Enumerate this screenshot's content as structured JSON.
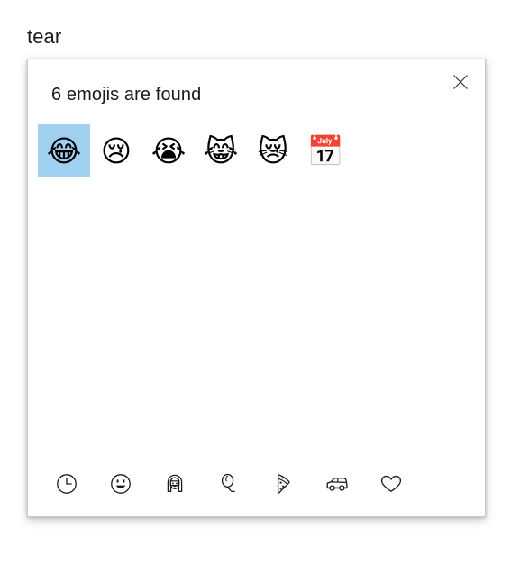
{
  "search_term": "tear",
  "panel": {
    "close_label": "✕",
    "results_header": "6 emojis are found",
    "accent_selection_color": "#9fd0f0",
    "border_color": "#c9c9c9",
    "background_color": "#ffffff"
  },
  "emoji_results": [
    {
      "glyph": "😂",
      "name": "face-with-tears-of-joy",
      "selected": true
    },
    {
      "glyph": "😢",
      "name": "crying-face",
      "selected": false
    },
    {
      "glyph": "😭",
      "name": "loudly-crying-face",
      "selected": false
    },
    {
      "glyph": "😹",
      "name": "cat-with-tears-of-joy",
      "selected": false
    },
    {
      "glyph": "😿",
      "name": "crying-cat",
      "selected": false
    },
    {
      "glyph": "📅",
      "name": "calendar",
      "selected": false
    }
  ],
  "categories": [
    {
      "icon": "clock-icon",
      "label": "Most recently used"
    },
    {
      "icon": "smiley-icon",
      "label": "Smileys and animals"
    },
    {
      "icon": "person-icon",
      "label": "People"
    },
    {
      "icon": "balloon-icon",
      "label": "Celebration and objects"
    },
    {
      "icon": "pizza-icon",
      "label": "Food and plants"
    },
    {
      "icon": "car-icon",
      "label": "Transportation and places"
    },
    {
      "icon": "heart-icon",
      "label": "Symbols"
    }
  ]
}
